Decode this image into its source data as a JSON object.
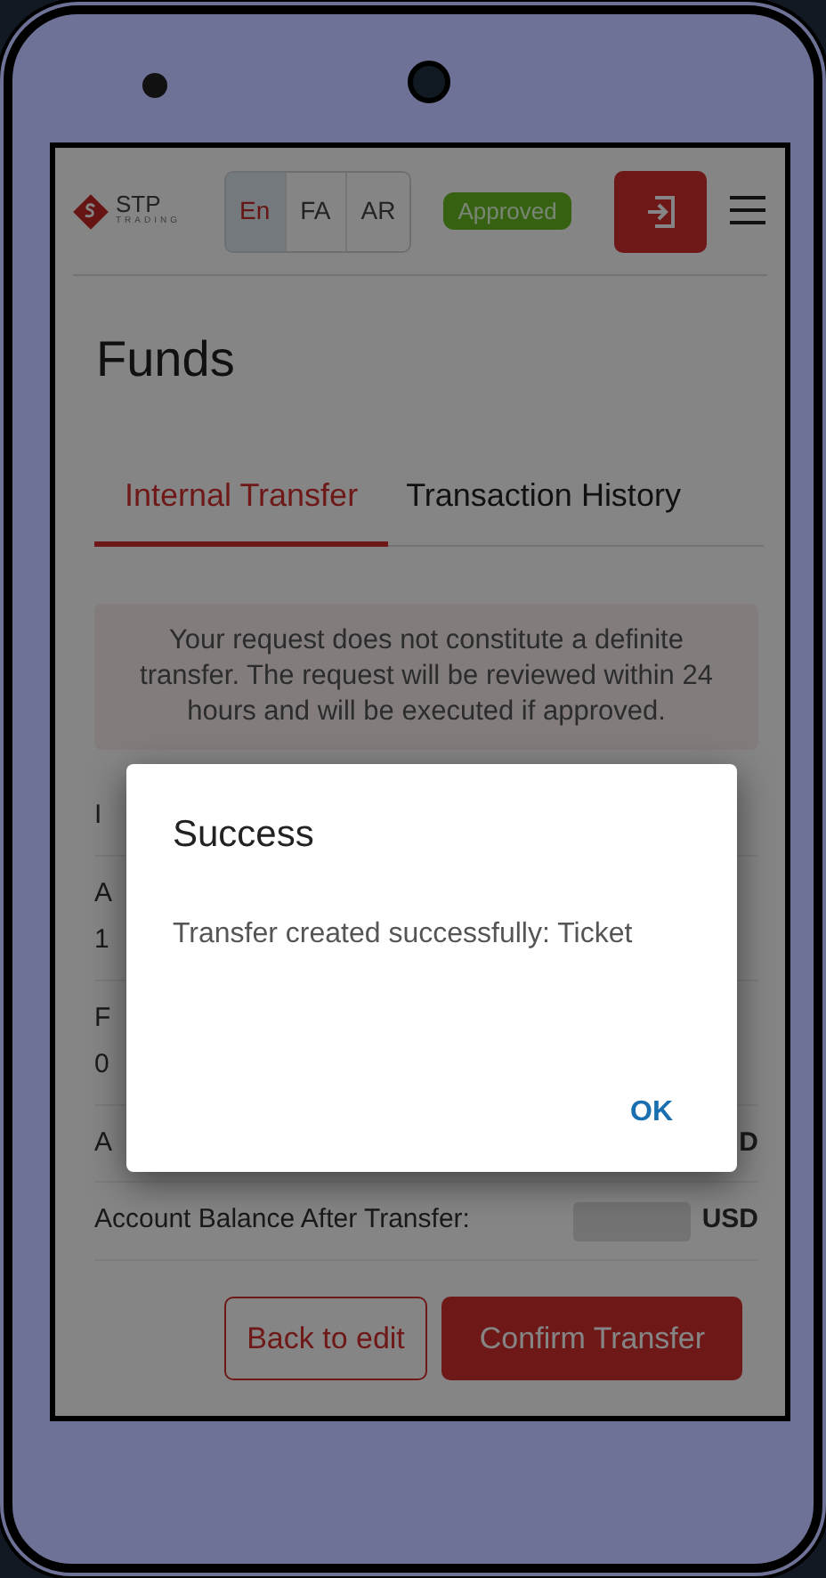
{
  "header": {
    "logo": {
      "brand": "STP",
      "tagline": "TRADING"
    },
    "languages": [
      {
        "label": "En",
        "selected": true
      },
      {
        "label": "FA",
        "selected": false
      },
      {
        "label": "AR",
        "selected": false
      }
    ],
    "status_badge": "Approved"
  },
  "page_title": "Funds",
  "tabs": [
    {
      "label": "Internal Transfer",
      "selected": true
    },
    {
      "label": "Transaction History",
      "selected": false
    }
  ],
  "notice": "Your request does not constitute a definite transfer. The request will be reviewed within 24 hours and will be executed if approved.",
  "rows": [
    {
      "kind": "single",
      "label": "I"
    },
    {
      "kind": "stacked",
      "label": "A",
      "value": "1"
    },
    {
      "kind": "stacked",
      "label": "F",
      "value": "0"
    },
    {
      "kind": "inline",
      "label": "A",
      "currency": "D"
    },
    {
      "kind": "inline",
      "label": "Account Balance After Transfer:",
      "masked": true,
      "currency": "USD"
    }
  ],
  "buttons": [
    {
      "label": "Back to edit",
      "kind": "outline"
    },
    {
      "label": "Confirm Transfer",
      "kind": "primary"
    }
  ],
  "dialog": {
    "title": "Success",
    "message": "Transfer created successfully: Ticket",
    "action": "OK"
  }
}
